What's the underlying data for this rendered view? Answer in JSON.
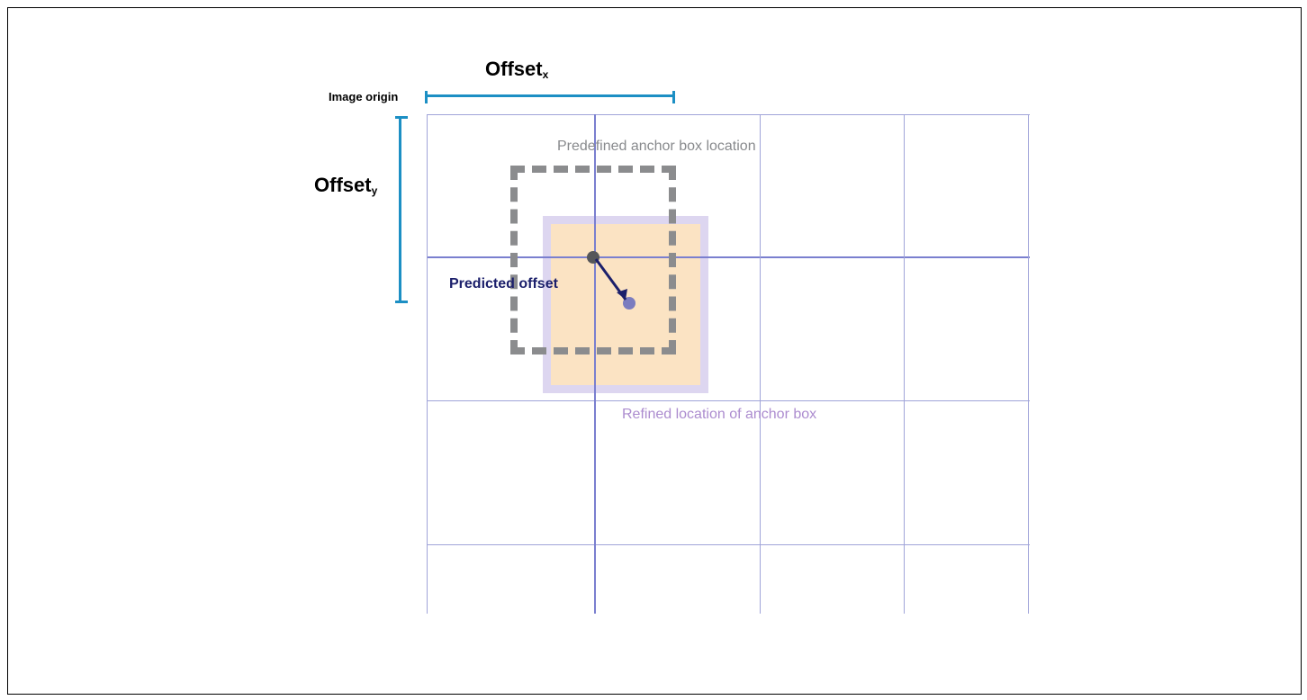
{
  "labels": {
    "offset_x": "Offset",
    "offset_x_sub": "x",
    "offset_y": "Offset",
    "offset_y_sub": "y",
    "image_origin": "Image origin",
    "anchor_box": "Predefined anchor box location",
    "predicted_offset": "Predicted offset",
    "refined": "Refined location of anchor box"
  },
  "diagram": {
    "grid_rows": 4,
    "grid_cols": 4,
    "anchor_center_cell": [
      1,
      1
    ],
    "predicted_offset_direction": "down-right",
    "colors": {
      "bracket": "#1c8fc4",
      "grid": "#a0a4d9",
      "grid_bold": "#7a7fcf",
      "anchor_dashed": "#8b8c8e",
      "refined_outer": "#d9d1ee",
      "refined_inner": "#fbe3c3",
      "predicted_text": "#1b1f6b",
      "refined_text": "#ac8ccf",
      "anchor_text": "#888a8d"
    }
  }
}
